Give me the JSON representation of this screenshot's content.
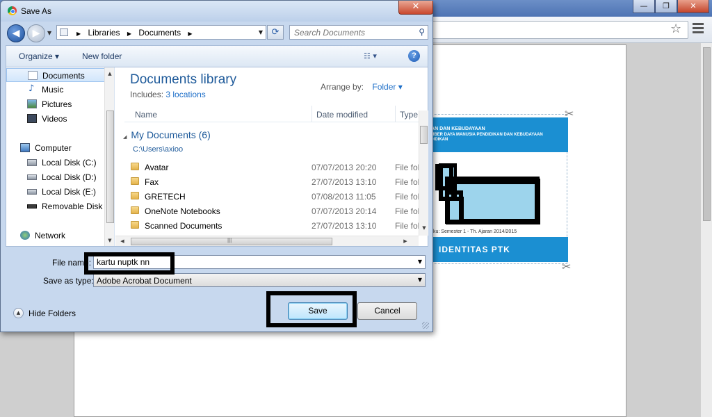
{
  "dialog": {
    "title": "Save As",
    "close_glyph": "✕",
    "nav": {
      "back_glyph": "◀",
      "forward_glyph": "▶",
      "history_glyph": "▼",
      "breadcrumb": [
        "Libraries",
        "Documents"
      ],
      "breadcrumb_sep": "▶",
      "address_dropdown_glyph": "▼",
      "refresh_glyph": "⟳",
      "search_placeholder": "Search Documents",
      "search_icon": "search-icon"
    },
    "toolbar": {
      "organize_label": "Organize ▾",
      "new_folder_label": "New folder",
      "view_label": "☷ ▾",
      "help_label": "?"
    },
    "navpane": {
      "items": [
        {
          "label": "Documents",
          "icon": "documents-icon",
          "selected": true
        },
        {
          "label": "Music",
          "icon": "music-icon"
        },
        {
          "label": "Pictures",
          "icon": "pictures-icon"
        },
        {
          "label": "Videos",
          "icon": "videos-icon"
        },
        {
          "label": "Computer",
          "icon": "computer-icon"
        },
        {
          "label": "Local Disk (C:)",
          "icon": "drive-icon"
        },
        {
          "label": "Local Disk (D:)",
          "icon": "drive-icon"
        },
        {
          "label": "Local Disk (E:)",
          "icon": "drive-icon"
        },
        {
          "label": "Removable Disk (",
          "icon": "removable-drive-icon"
        },
        {
          "label": "Network",
          "icon": "network-icon"
        }
      ],
      "scroll_up": "▲",
      "scroll_down": "▼"
    },
    "library": {
      "title": "Documents library",
      "includes_label": "Includes:",
      "includes_link": "3 locations",
      "arrange_label": "Arrange by:",
      "arrange_value": "Folder ▾"
    },
    "columns": {
      "name": "Name",
      "date": "Date modified",
      "type": "Type"
    },
    "group": {
      "toggle_glyph": "◢",
      "title": "My Documents (6)",
      "path": "C:\\Users\\axioo"
    },
    "files": [
      {
        "name": "Avatar",
        "date": "07/07/2013 20:20",
        "type": "File fol"
      },
      {
        "name": "Fax",
        "date": "27/07/2013 13:10",
        "type": "File fol"
      },
      {
        "name": "GRETECH",
        "date": "07/08/2013 11:05",
        "type": "File fol"
      },
      {
        "name": "OneNote Notebooks",
        "date": "07/07/2013 20:14",
        "type": "File fol"
      },
      {
        "name": "Scanned Documents",
        "date": "27/07/2013 13:10",
        "type": "File fol"
      }
    ],
    "hscroll": {
      "left": "◀",
      "right": "▶",
      "grip": "|||"
    },
    "file_name_label": "File name:",
    "file_name_value": "kartu nuptk nn",
    "file_name_dropdown": "▼",
    "save_as_type_label": "Save as type:",
    "save_as_type_value": "Adobe Acrobat Document",
    "save_as_type_dropdown": "▼",
    "hide_folders_glyph": "▲",
    "hide_folders_label": "Hide Folders",
    "save_label": "Save",
    "cancel_label": "Cancel"
  },
  "browser": {
    "window_buttons": [
      "—",
      "❐",
      "✕"
    ],
    "star_glyph": "☆",
    "card": {
      "header_line1": "KAN DAN KEBUDAYAAN",
      "header_line2": "UMBER DAYA MANUSIA PENDIDIKAN DAN KEBUDAYAAN",
      "header_line3": "NDIDIKAN",
      "semester": "ku:   Semester 1 - Th. Ajaran 2014/2015",
      "id_band": "IDENTITAS PTK",
      "scissors": "✂"
    }
  },
  "colors": {
    "accent_blue": "#1b8fd2",
    "dialog_frame": "#c7d8ee",
    "link": "#1e6fc8",
    "annotation": "#000000"
  }
}
